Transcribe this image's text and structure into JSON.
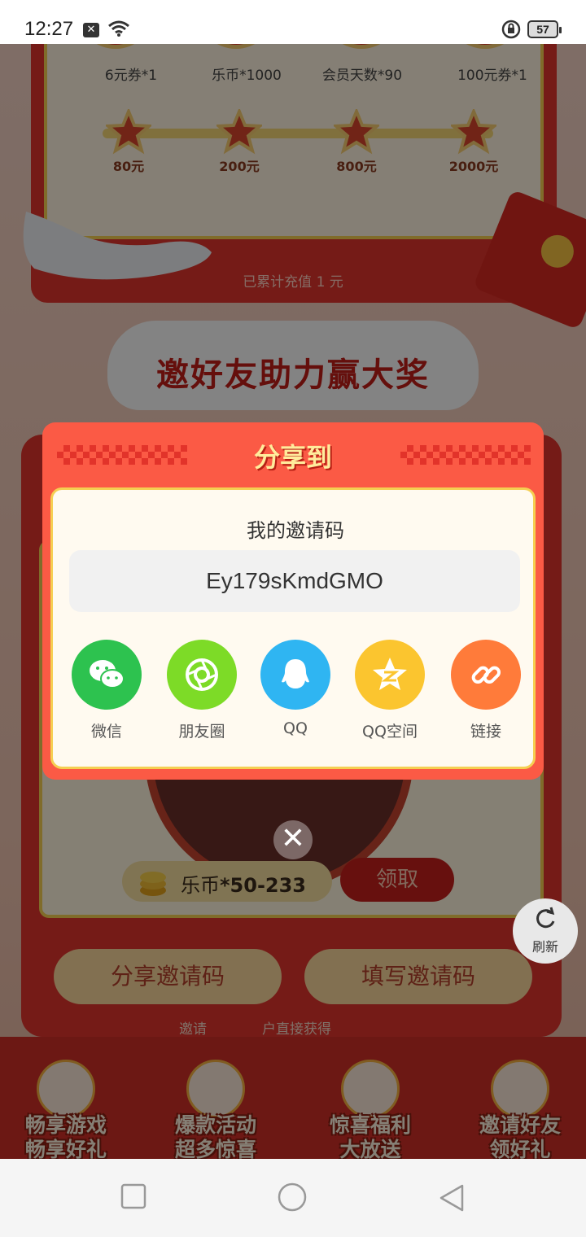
{
  "status_bar": {
    "time": "12:27",
    "battery": "57"
  },
  "rewards": {
    "top_labels": [
      "6元券*1",
      "乐币*1000",
      "会员天数*90",
      "100元券*1"
    ],
    "milestones": [
      "80元",
      "200元",
      "800元",
      "2000元"
    ],
    "caption": "已累计充值 1 元"
  },
  "invite": {
    "title": "邀好友助力赢大奖",
    "coin_text": "乐币",
    "coin_amount": "*50-233",
    "claim_label": "领取",
    "share_code_label": "分享邀请码",
    "fill_code_label": "填写邀请码",
    "hint_prefix": "邀请",
    "hint_suffix": "户直接获得"
  },
  "refresh": {
    "label": "刷新"
  },
  "footer": [
    {
      "line1": "畅享游戏",
      "line2": "畅享好礼"
    },
    {
      "line1": "爆款活动",
      "line2": "超多惊喜"
    },
    {
      "line1": "惊喜福利",
      "line2": "大放送"
    },
    {
      "line1": "邀请好友",
      "line2": "领好礼"
    }
  ],
  "dialog": {
    "title": "分享到",
    "code_label": "我的邀请码",
    "code": "Ey179sKmdGMO",
    "share_targets": [
      {
        "label": "微信",
        "icon": "wechat-icon",
        "color": "#2dc24f"
      },
      {
        "label": "朋友圈",
        "icon": "moments-icon",
        "color": "#7ddb27"
      },
      {
        "label": "QQ",
        "icon": "qq-icon",
        "color": "#2fb5f2"
      },
      {
        "label": "QQ空间",
        "icon": "qzone-icon",
        "color": "#fbc52f"
      },
      {
        "label": "链接",
        "icon": "link-icon",
        "color": "#ff7b3a"
      }
    ]
  },
  "colors": {
    "dialog_bg": "#fb5a45",
    "accent_gold": "#f5cf52",
    "primary_red": "#e0352c"
  }
}
